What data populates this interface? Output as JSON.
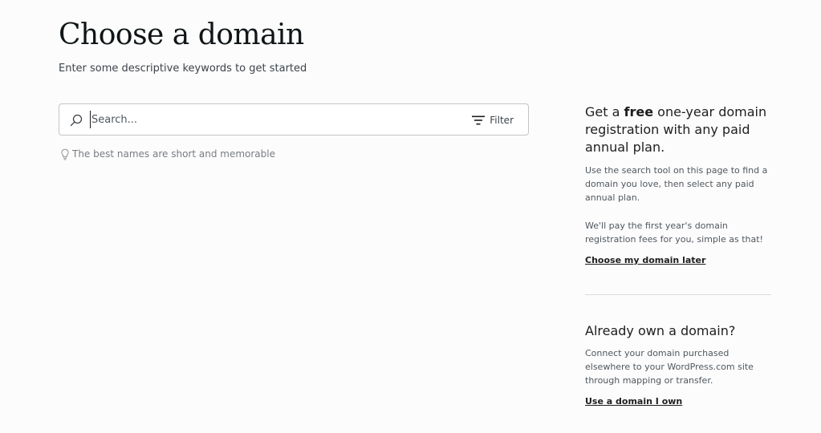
{
  "header": {
    "title": "Choose a domain",
    "subtitle": "Enter some descriptive keywords to get started"
  },
  "search": {
    "placeholder": "Search...",
    "value": "",
    "icon": "search-icon",
    "filter_label": "Filter",
    "filter_icon": "filter-icon"
  },
  "hint": {
    "icon": "lightbulb-icon",
    "text": "The best names are short and memorable"
  },
  "sidebar": {
    "promo": {
      "heading_before": "Get a ",
      "heading_bold": "free",
      "heading_after": " one-year domain registration with any paid annual plan.",
      "text_1": "Use the search tool on this page to find a domain you love, then select any paid annual plan.",
      "text_2": "We'll pay the first year's domain registration fees for you, simple as that!",
      "link": "Choose my domain later"
    },
    "own_domain": {
      "heading": "Already own a domain?",
      "text": "Connect your domain purchased elsewhere to your WordPress.com site through mapping or transfer.",
      "link": "Use a domain I own"
    }
  }
}
